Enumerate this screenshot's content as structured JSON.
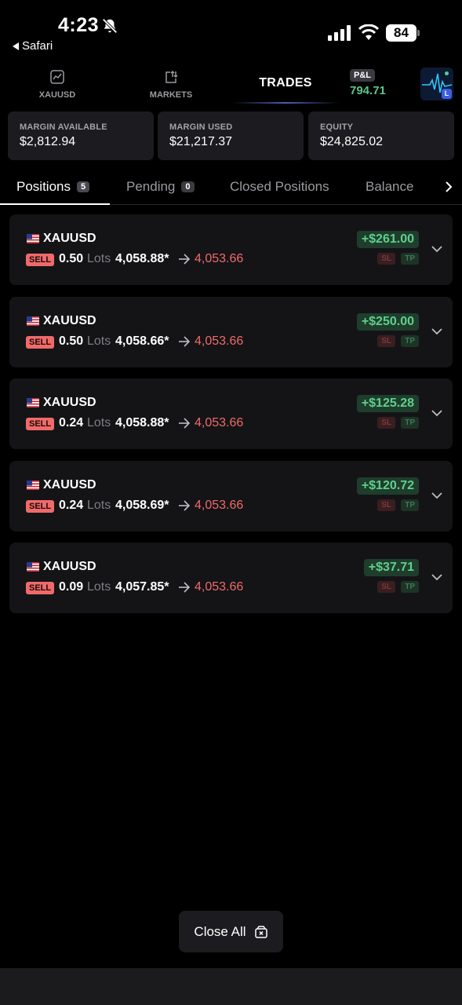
{
  "status_bar": {
    "time": "4:23",
    "back_app": "Safari",
    "battery": "84",
    "icons": [
      "bell-slash-icon",
      "signal-icon",
      "wifi-icon",
      "battery-icon"
    ]
  },
  "top_nav": {
    "items": [
      {
        "label": "XAUUSD",
        "icon": "chart-icon"
      },
      {
        "label": "MARKETS",
        "icon": "markets-icon"
      }
    ],
    "active": "TRADES",
    "pnl_label": "P&L",
    "pnl_value": "794.71",
    "pulse_badge": "L"
  },
  "account": {
    "margin_available": {
      "label": "MARGIN AVAILABLE",
      "value": "$2,812.94"
    },
    "margin_used": {
      "label": "MARGIN USED",
      "value": "$21,217.37"
    },
    "equity": {
      "label": "EQUITY",
      "value": "$24,825.02"
    }
  },
  "tabs": [
    {
      "label": "Positions",
      "count": "5",
      "active": true
    },
    {
      "label": "Pending",
      "count": "0"
    },
    {
      "label": "Closed Positions"
    },
    {
      "label": "Balance"
    }
  ],
  "positions": [
    {
      "symbol": "XAUUSD",
      "side": "SELL",
      "lots": "0.50",
      "lots_label": "Lots",
      "open_price": "4,058.88*",
      "current_price": "4,053.66",
      "pnl": "+$261.00",
      "sl": "SL",
      "tp": "TP"
    },
    {
      "symbol": "XAUUSD",
      "side": "SELL",
      "lots": "0.50",
      "lots_label": "Lots",
      "open_price": "4,058.66*",
      "current_price": "4,053.66",
      "pnl": "+$250.00",
      "sl": "SL",
      "tp": "TP"
    },
    {
      "symbol": "XAUUSD",
      "side": "SELL",
      "lots": "0.24",
      "lots_label": "Lots",
      "open_price": "4,058.88*",
      "current_price": "4,053.66",
      "pnl": "+$125.28",
      "sl": "SL",
      "tp": "TP"
    },
    {
      "symbol": "XAUUSD",
      "side": "SELL",
      "lots": "0.24",
      "lots_label": "Lots",
      "open_price": "4,058.69*",
      "current_price": "4,053.66",
      "pnl": "+$120.72",
      "sl": "SL",
      "tp": "TP"
    },
    {
      "symbol": "XAUUSD",
      "side": "SELL",
      "lots": "0.09",
      "lots_label": "Lots",
      "open_price": "4,057.85*",
      "current_price": "4,053.66",
      "pnl": "+$37.71",
      "sl": "SL",
      "tp": "TP"
    }
  ],
  "actions": {
    "close_all": "Close All"
  },
  "colors": {
    "profit": "#5fd08c",
    "loss": "#f06a6a",
    "card": "#141417",
    "accent": "#4b5fb0"
  }
}
